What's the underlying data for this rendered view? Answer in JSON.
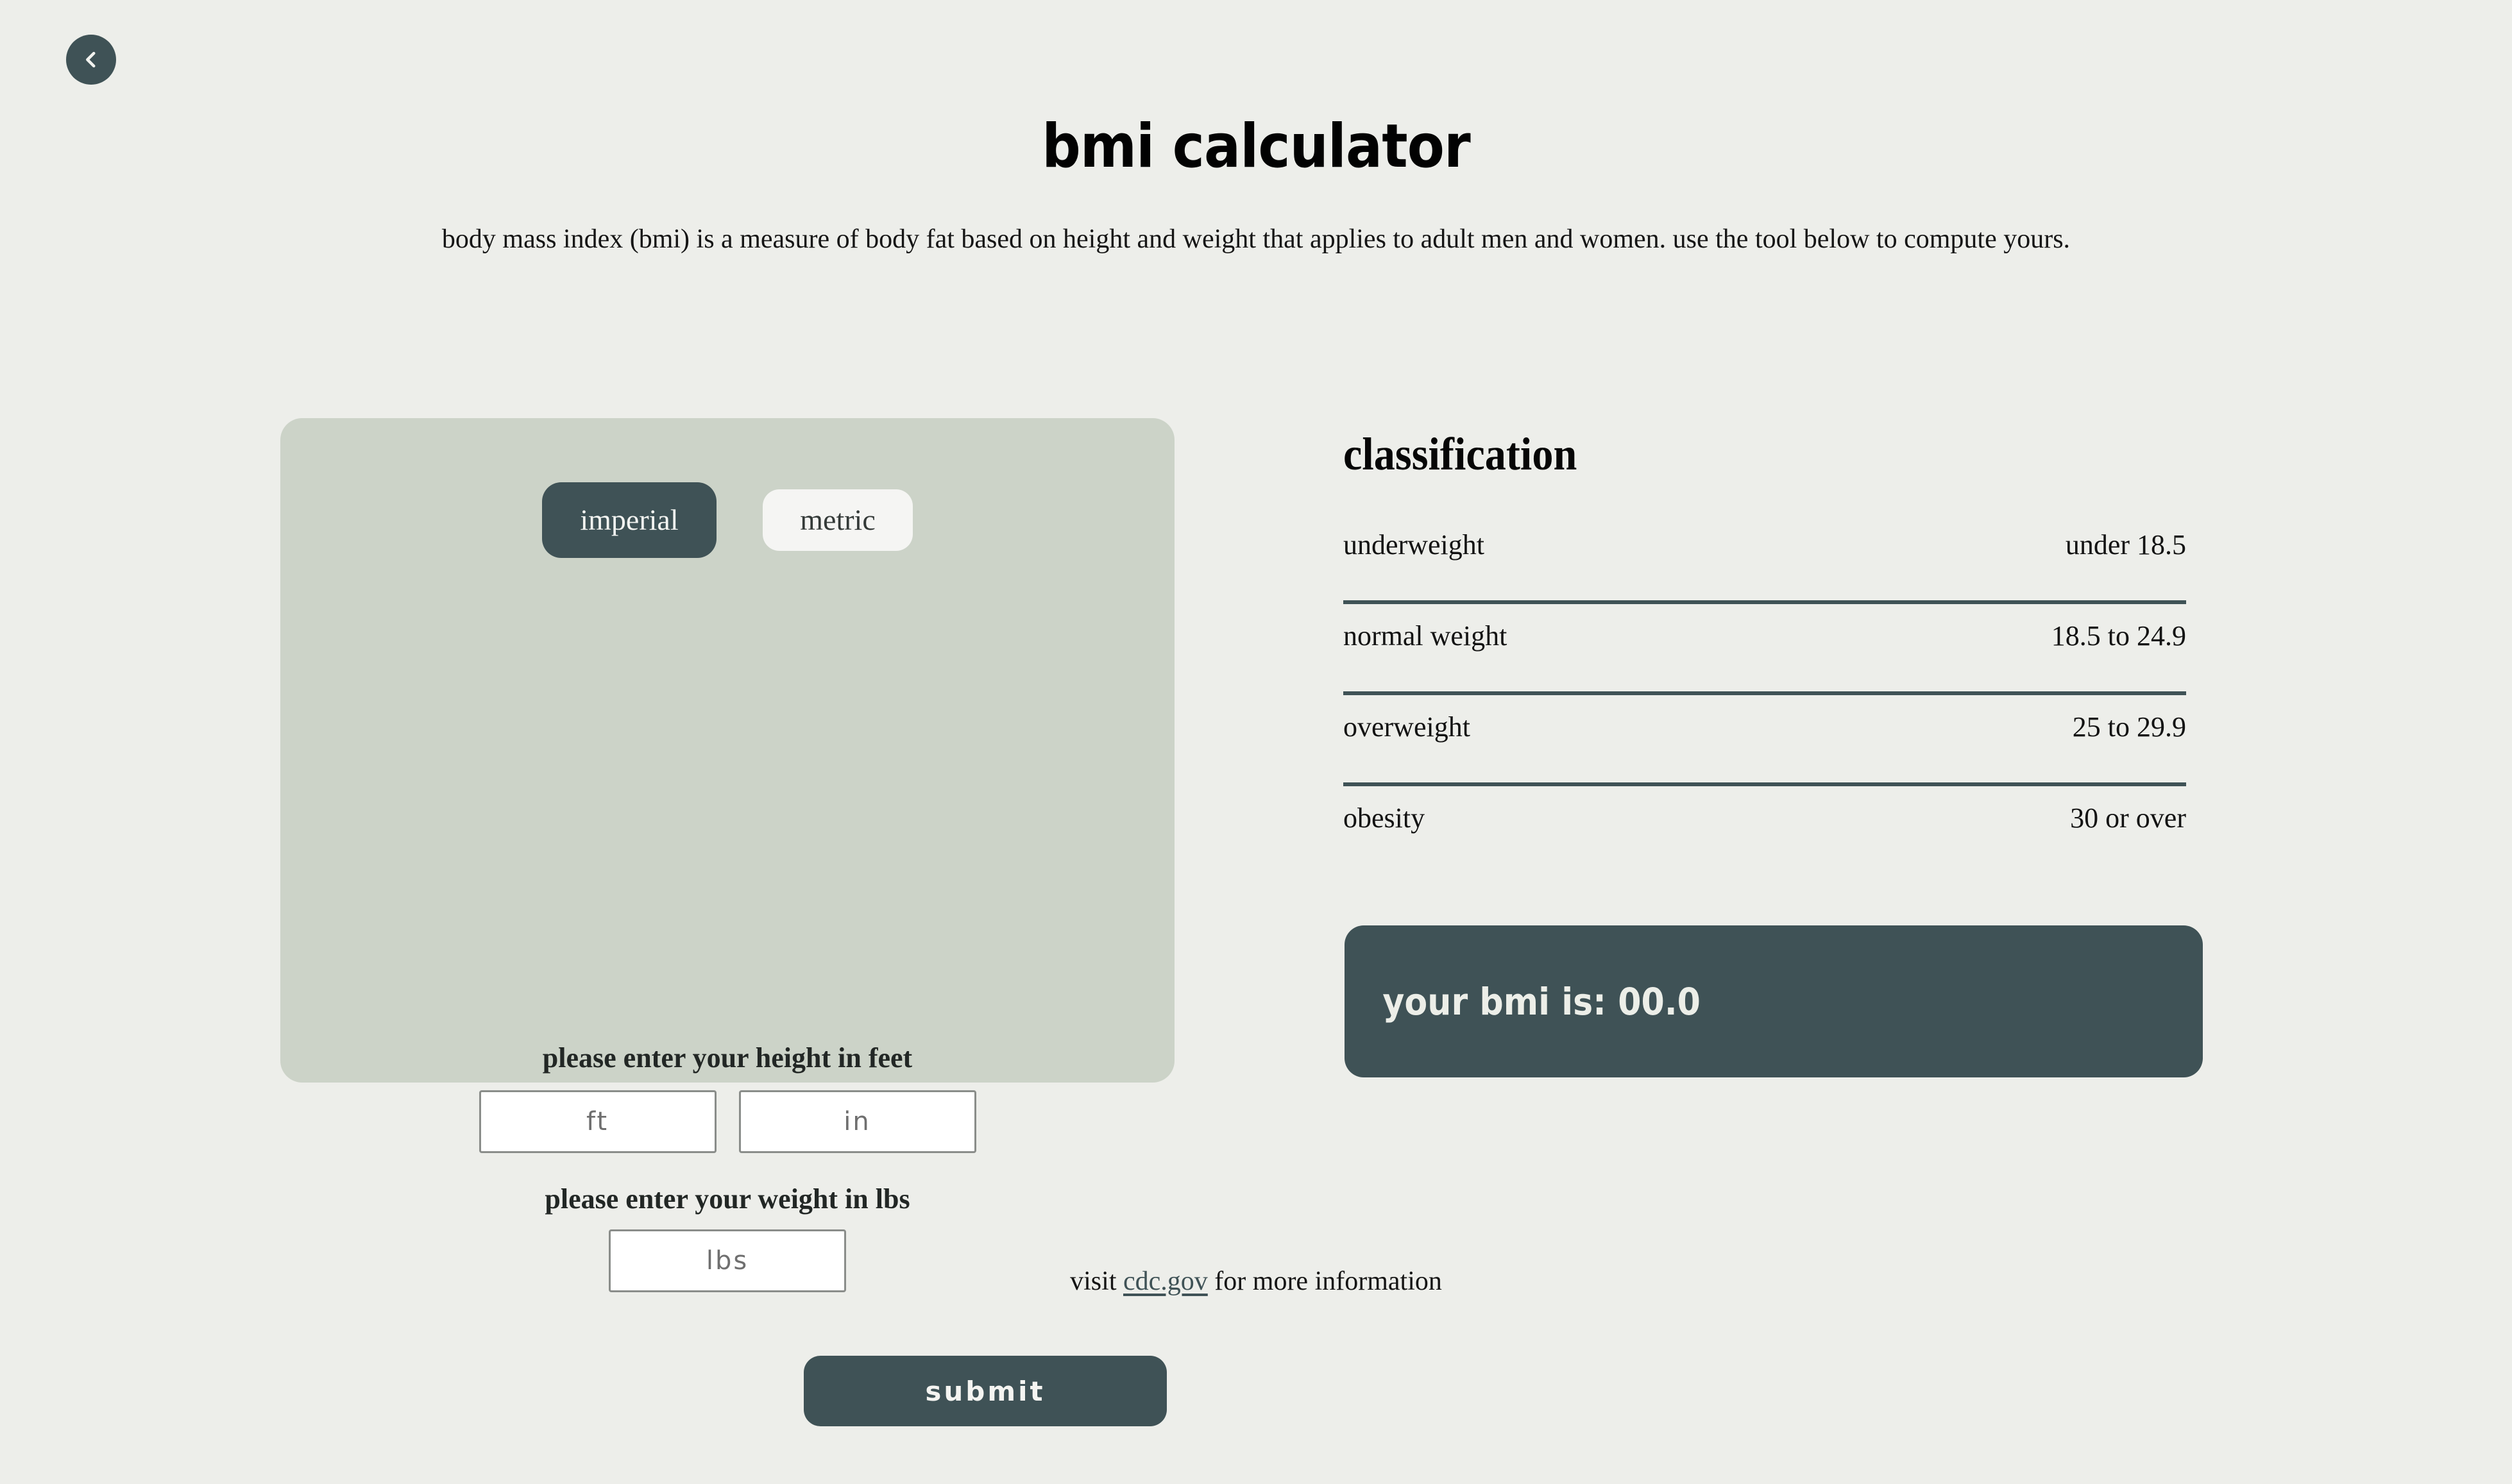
{
  "theme": {
    "background": "#edeeea",
    "card_background": "#ccd3c8",
    "accent_dark": "#3f5256",
    "input_background": "#ffffff",
    "inactive_toggle_background": "#f5f5f3"
  },
  "nav": {
    "back_button_label": "",
    "back_icon": "chevron-left-icon"
  },
  "header": {
    "title": "bmi calculator",
    "subtitle": "body mass index (bmi) is a measure of body fat based on height and weight that applies to adult men and women. use the tool below to compute yours."
  },
  "calculator": {
    "units": {
      "options": [
        {
          "label": "imperial",
          "active": true
        },
        {
          "label": "metric",
          "active": false
        }
      ]
    },
    "height": {
      "label": "please enter your height in feet",
      "feet": {
        "value": "",
        "placeholder": "ft"
      },
      "inches": {
        "value": "",
        "placeholder": "in"
      }
    },
    "weight": {
      "label": "please enter your weight in lbs",
      "pounds": {
        "value": "",
        "placeholder": "lbs"
      }
    },
    "submit_label": "submit"
  },
  "classification": {
    "heading": "classification",
    "rows": [
      {
        "name": "underweight",
        "range": "under 18.5"
      },
      {
        "name": "normal weight",
        "range": "18.5 to 24.9"
      },
      {
        "name": "overweight",
        "range": "25 to 29.9"
      },
      {
        "name": "obesity",
        "range": "30 or over"
      }
    ]
  },
  "result": {
    "text": "your bmi is: 00.0"
  },
  "footer": {
    "prefix": "visit ",
    "link_text": "cdc.gov",
    "suffix": " for more information"
  }
}
